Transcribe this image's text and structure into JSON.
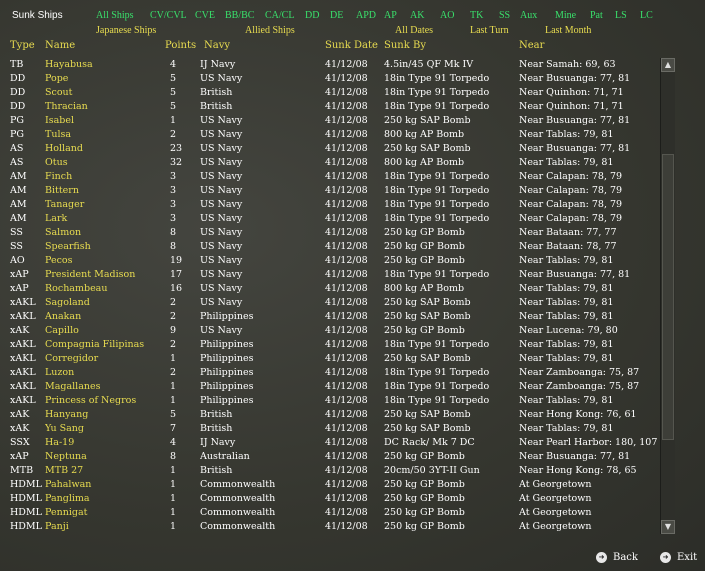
{
  "title": "Sunk Ships",
  "filters_row1": [
    "All Ships",
    "CV/CVL",
    "CVE",
    "BB/BC",
    "CA/CL",
    "DD",
    "DE",
    "APD",
    "AP",
    "AK",
    "AO",
    "TK",
    "SS",
    "Aux",
    "Mine",
    "Pat",
    "LS",
    "LC"
  ],
  "filters_row2": [
    "Japanese Ships",
    "Allied Ships",
    "All Dates",
    "Last Turn",
    "Last Month"
  ],
  "headers": {
    "type": "Type",
    "name": "Name",
    "points": "Points",
    "navy": "Navy",
    "date": "Sunk Date",
    "by": "Sunk By",
    "near": "Near"
  },
  "rows": [
    [
      "TB",
      "Hayabusa",
      "4",
      "IJ Navy",
      "41/12/08",
      "4.5in/45 QF Mk IV",
      "Near Samah: 69, 63"
    ],
    [
      "DD",
      "Pope",
      "5",
      "US Navy",
      "41/12/08",
      "18in Type 91 Torpedo",
      "Near Busuanga: 77, 81"
    ],
    [
      "DD",
      "Scout",
      "5",
      "British",
      "41/12/08",
      "18in Type 91 Torpedo",
      "Near Quinhon: 71, 71"
    ],
    [
      "DD",
      "Thracian",
      "5",
      "British",
      "41/12/08",
      "18in Type 91 Torpedo",
      "Near Quinhon: 71, 71"
    ],
    [
      "PG",
      "Isabel",
      "1",
      "US Navy",
      "41/12/08",
      "250 kg SAP Bomb",
      "Near Busuanga: 77, 81"
    ],
    [
      "PG",
      "Tulsa",
      "2",
      "US Navy",
      "41/12/08",
      "800 kg AP Bomb",
      "Near Tablas: 79, 81"
    ],
    [
      "AS",
      "Holland",
      "23",
      "US Navy",
      "41/12/08",
      "250 kg SAP Bomb",
      "Near Busuanga: 77, 81"
    ],
    [
      "AS",
      "Otus",
      "32",
      "US Navy",
      "41/12/08",
      "800 kg AP Bomb",
      "Near Tablas: 79, 81"
    ],
    [
      "AM",
      "Finch",
      "3",
      "US Navy",
      "41/12/08",
      "18in Type 91 Torpedo",
      "Near Calapan: 78, 79"
    ],
    [
      "AM",
      "Bittern",
      "3",
      "US Navy",
      "41/12/08",
      "18in Type 91 Torpedo",
      "Near Calapan: 78, 79"
    ],
    [
      "AM",
      "Tanager",
      "3",
      "US Navy",
      "41/12/08",
      "18in Type 91 Torpedo",
      "Near Calapan: 78, 79"
    ],
    [
      "AM",
      "Lark",
      "3",
      "US Navy",
      "41/12/08",
      "18in Type 91 Torpedo",
      "Near Calapan: 78, 79"
    ],
    [
      "SS",
      "Salmon",
      "8",
      "US Navy",
      "41/12/08",
      "250 kg GP Bomb",
      "Near Bataan: 77, 77"
    ],
    [
      "SS",
      "Spearfish",
      "8",
      "US Navy",
      "41/12/08",
      "250 kg GP Bomb",
      "Near Bataan: 78, 77"
    ],
    [
      "AO",
      "Pecos",
      "19",
      "US Navy",
      "41/12/08",
      "250 kg GP Bomb",
      "Near Tablas: 79, 81"
    ],
    [
      "xAP",
      "President Madison",
      "17",
      "US Navy",
      "41/12/08",
      "18in Type 91 Torpedo",
      "Near Busuanga: 77, 81"
    ],
    [
      "xAP",
      "Rochambeau",
      "16",
      "US Navy",
      "41/12/08",
      "800 kg AP Bomb",
      "Near Tablas: 79, 81"
    ],
    [
      "xAKL",
      "Sagoland",
      "2",
      "US Navy",
      "41/12/08",
      "250 kg SAP Bomb",
      "Near Tablas: 79, 81"
    ],
    [
      "xAKL",
      "Anakan",
      "2",
      "Philippines",
      "41/12/08",
      "250 kg SAP Bomb",
      "Near Tablas: 79, 81"
    ],
    [
      "xAK",
      "Capillo",
      "9",
      "US Navy",
      "41/12/08",
      "250 kg GP Bomb",
      "Near Lucena: 79, 80"
    ],
    [
      "xAKL",
      "Compagnia Filipinas",
      "2",
      "Philippines",
      "41/12/08",
      "18in Type 91 Torpedo",
      "Near Tablas: 79, 81"
    ],
    [
      "xAKL",
      "Corregidor",
      "1",
      "Philippines",
      "41/12/08",
      "250 kg SAP Bomb",
      "Near Tablas: 79, 81"
    ],
    [
      "xAKL",
      "Luzon",
      "2",
      "Philippines",
      "41/12/08",
      "18in Type 91 Torpedo",
      "Near Zamboanga: 75, 87"
    ],
    [
      "xAKL",
      "Magallanes",
      "1",
      "Philippines",
      "41/12/08",
      "18in Type 91 Torpedo",
      "Near Zamboanga: 75, 87"
    ],
    [
      "xAKL",
      "Princess of Negros",
      "1",
      "Philippines",
      "41/12/08",
      "18in Type 91 Torpedo",
      "Near Tablas: 79, 81"
    ],
    [
      "xAK",
      "Hanyang",
      "5",
      "British",
      "41/12/08",
      "250 kg SAP Bomb",
      "Near Hong Kong: 76, 61"
    ],
    [
      "xAK",
      "Yu Sang",
      "7",
      "British",
      "41/12/08",
      "250 kg SAP Bomb",
      "Near Tablas: 79, 81"
    ],
    [
      "SSX",
      "Ha-19",
      "4",
      "IJ Navy",
      "41/12/08",
      "DC Rack/ Mk 7 DC",
      "Near Pearl Harbor: 180, 107"
    ],
    [
      "xAP",
      "Neptuna",
      "8",
      "Australian",
      "41/12/08",
      "250 kg GP Bomb",
      "Near Busuanga: 77, 81"
    ],
    [
      "MTB",
      "MTB 27",
      "1",
      "British",
      "41/12/08",
      "20cm/50 3YT-II Gun",
      "Near Hong Kong: 78, 65"
    ],
    [
      "HDML",
      "Pahalwan",
      "1",
      "Commonwealth",
      "41/12/08",
      "250 kg GP Bomb",
      "At Georgetown"
    ],
    [
      "HDML",
      "Panglima",
      "1",
      "Commonwealth",
      "41/12/08",
      "250 kg GP Bomb",
      "At Georgetown"
    ],
    [
      "HDML",
      "Pennigat",
      "1",
      "Commonwealth",
      "41/12/08",
      "250 kg GP Bomb",
      "At Georgetown"
    ],
    [
      "HDML",
      "Panji",
      "1",
      "Commonwealth",
      "41/12/08",
      "250 kg GP Bomb",
      "At Georgetown"
    ]
  ],
  "nav": {
    "back": "Back",
    "exit": "Exit"
  },
  "colors": {
    "green_filter": "#39e06b",
    "yellow": "#e8dc50",
    "background": "#3a3b36"
  }
}
